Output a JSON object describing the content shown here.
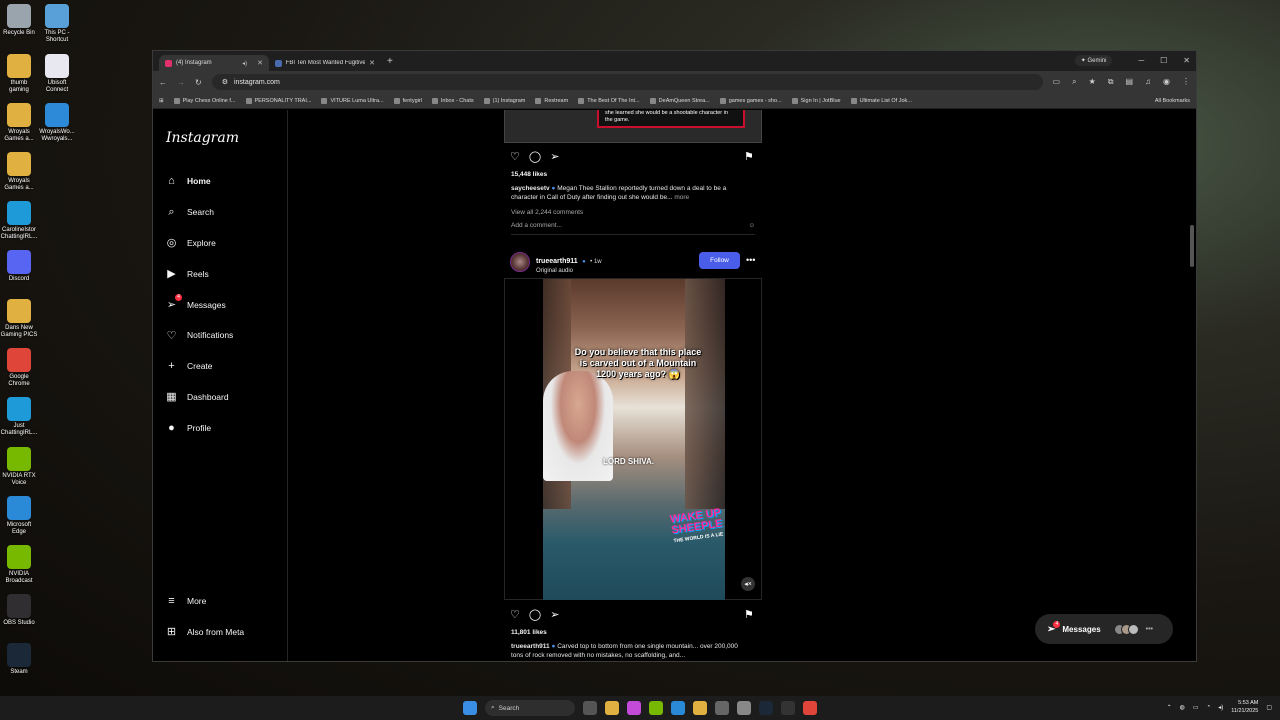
{
  "desktop": {
    "icons": [
      {
        "label": "Recycle Bin",
        "color": "#9aa4ad"
      },
      {
        "label": "This PC - Shortcut",
        "color": "#5aa0d8"
      },
      {
        "label": "thumb gaming",
        "color": "#e0b040"
      },
      {
        "label": "Ubisoft Connect",
        "color": "#e8e8f0"
      },
      {
        "label": "Wroyals Games a...",
        "color": "#e0b040"
      },
      {
        "label": "WroyalsWo... Wwroyals...",
        "color": "#2c8ad8"
      },
      {
        "label": "Wroyals Games a...",
        "color": "#e0b040"
      },
      {
        "label": "CarolineIstor ChattingIRL...",
        "color": "#1f9ad8"
      },
      {
        "label": "Discord",
        "color": "#5865f2"
      },
      {
        "label": "Dans New Gaming PICS",
        "color": "#e0b040"
      },
      {
        "label": "Google Chrome",
        "color": "#e0453a"
      },
      {
        "label": "Just ChattingIRL...",
        "color": "#1f9ad8"
      },
      {
        "label": "NVIDIA RTX Voice",
        "color": "#76b900"
      },
      {
        "label": "Microsoft Edge",
        "color": "#2a8ad8"
      },
      {
        "label": "NVIDIA Broadcast",
        "color": "#76b900"
      },
      {
        "label": "OBS Studio",
        "color": "#302e31"
      },
      {
        "label": "Steam",
        "color": "#1b2838"
      }
    ]
  },
  "browser": {
    "tabs": [
      {
        "label": "(4) Instagram",
        "active": true
      },
      {
        "label": "FBI Ten Most Wanted Fugitives",
        "active": false
      }
    ],
    "new_tab": "+",
    "gemini": "Gemini",
    "url": "instagram.com",
    "bookmarks": [
      "Play Chess Online f...",
      "PERSONALITY TRAI...",
      "VITURE Luma Ultra...",
      "fentygirl",
      "Inbox - Chats",
      "(1) Instagram",
      "Restream",
      "The Best Of The Int...",
      "DeAmQueen Strea...",
      "games games - sho...",
      "Sign In | JotBlue",
      "Ultimate List Of Jok..."
    ],
    "all_bookmarks": "All Bookmarks"
  },
  "instagram": {
    "logo": "Instagram",
    "nav": [
      {
        "label": "Home",
        "icon": "⌂",
        "bold": true
      },
      {
        "label": "Search",
        "icon": "⌕"
      },
      {
        "label": "Explore",
        "icon": "◎"
      },
      {
        "label": "Reels",
        "icon": "▶"
      },
      {
        "label": "Messages",
        "icon": "➢",
        "badge": "4"
      },
      {
        "label": "Notifications",
        "icon": "♡"
      },
      {
        "label": "Create",
        "icon": "+"
      },
      {
        "label": "Dashboard",
        "icon": "▦"
      },
      {
        "label": "Profile",
        "icon": "●"
      }
    ],
    "bottom_nav": [
      {
        "label": "More",
        "icon": "≡"
      },
      {
        "label": "Also from Meta",
        "icon": "⊞"
      }
    ],
    "post1": {
      "overlay_text": "she learned she would be a shootable character in the game.",
      "likes": "15,448 likes",
      "username": "saycheesetv",
      "caption": "Megan Thee Stallion reportedly turned down a deal to be a character in Call of Duty after finding out she would be...",
      "more": "more",
      "comments": "View all 2,244 comments",
      "add_comment": "Add a comment..."
    },
    "post2": {
      "username": "trueearth911",
      "time": "• 1w",
      "subtitle": "Original audio",
      "follow": "Follow",
      "video_caption": "Do you believe that this place is carved out of a Mountain 1200 years ago?",
      "video_caption2": "LORD SHIVA.",
      "brand_top": "WAKE UP",
      "brand_bottom": "SHEEPLE",
      "brand_small": "THE WORLD IS A LIE",
      "likes": "11,801 likes",
      "caption": "Carved top to bottom from one single mountain... over 200,000 tons of rock removed with no mistakes, no scaffolding, and..."
    },
    "messages_pill": {
      "label": "Messages",
      "badge": "4"
    }
  },
  "taskbar": {
    "search": "Search",
    "time": "5:53 AM",
    "date": "11/21/2025"
  }
}
